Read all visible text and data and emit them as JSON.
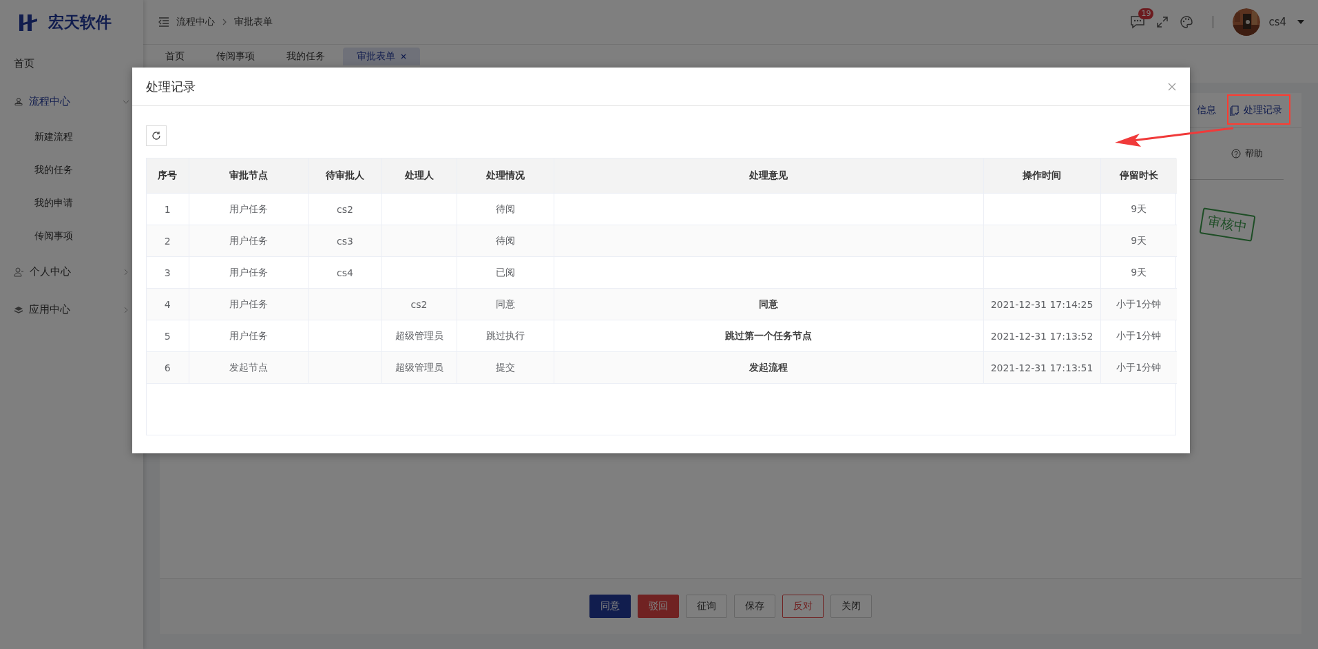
{
  "brand": {
    "name": "宏天软件"
  },
  "sidebar": {
    "items": [
      {
        "label": "首页",
        "selected": false
      },
      {
        "label": "流程中心",
        "selected": true,
        "expanded": true,
        "children": [
          {
            "label": "新建流程",
            "selected": false
          },
          {
            "label": "我的任务",
            "selected": false
          },
          {
            "label": "我的申请",
            "selected": false
          },
          {
            "label": "传阅事项",
            "selected": false
          }
        ]
      },
      {
        "label": "个人中心",
        "selected": false,
        "expanded": false
      },
      {
        "label": "应用中心",
        "selected": false,
        "expanded": false
      }
    ]
  },
  "header": {
    "breadcrumb": [
      "流程中心",
      "审批表单"
    ],
    "message_count": "19",
    "user": "cs4"
  },
  "tabs": [
    {
      "label": "首页",
      "selected": false
    },
    {
      "label": "传阅事项",
      "selected": false
    },
    {
      "label": "我的任务",
      "selected": false
    },
    {
      "label": "审批表单",
      "selected": true
    }
  ],
  "toolbar": {
    "links": [
      "信息",
      "处理记录"
    ],
    "help": "帮助"
  },
  "stamp": "审核中",
  "actions": [
    {
      "label": "同意",
      "kind": "primary"
    },
    {
      "label": "驳回",
      "kind": "danger"
    },
    {
      "label": "征询",
      "kind": "default"
    },
    {
      "label": "保存",
      "kind": "default"
    },
    {
      "label": "反对",
      "kind": "danger-outline"
    },
    {
      "label": "关闭",
      "kind": "default"
    }
  ],
  "dialog": {
    "title": "处理记录",
    "columns": [
      "序号",
      "审批节点",
      "待审批人",
      "处理人",
      "处理情况",
      "处理意见",
      "操作时间",
      "停留时长"
    ],
    "rows": [
      [
        "1",
        "用户任务",
        "cs2",
        null,
        "待阅",
        null,
        null,
        "9天"
      ],
      [
        "2",
        "用户任务",
        "cs3",
        null,
        "待阅",
        null,
        null,
        "9天"
      ],
      [
        "3",
        "用户任务",
        "cs4",
        null,
        "已阅",
        null,
        null,
        "9天"
      ],
      [
        "4",
        "用户任务",
        null,
        "cs2",
        "同意",
        "同意",
        "2021-12-31 17:14:25",
        "小于1分钟"
      ],
      [
        "5",
        "用户任务",
        null,
        "超级管理员",
        "跳过执行",
        "跳过第一个任务节点",
        "2021-12-31 17:13:52",
        "小于1分钟"
      ],
      [
        "6",
        "发起节点",
        null,
        "超级管理员",
        "提交",
        "发起流程",
        "2021-12-31 17:13:51",
        "小于1分钟"
      ]
    ]
  }
}
